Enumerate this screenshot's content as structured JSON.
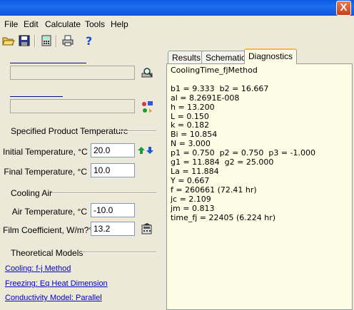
{
  "window": {
    "close_label": "X"
  },
  "menu": [
    "File",
    "Edit",
    "Calculate",
    "Tools",
    "Help"
  ],
  "toolbar_icons": [
    "open-folder-icon",
    "save-icon",
    "calculator-icon",
    "print-icon",
    "help-icon"
  ],
  "tabs": [
    {
      "label": "Results",
      "active": false
    },
    {
      "label": "Schematic",
      "active": false
    },
    {
      "label": "Diagnostics",
      "active": true
    }
  ],
  "product_temp": {
    "heading": "Specified Product Temperature",
    "initial_label": "Initial Temperature, °C",
    "initial_value": "20.0",
    "final_label": "Final Temperature, °C",
    "final_value": "10.0"
  },
  "cooling_air": {
    "heading": "Cooling Air",
    "air_label": "Air Temperature, °C",
    "air_value": "-10.0",
    "film_label": "Film Coefficient, W/m?°C",
    "film_value": "13.2"
  },
  "models": {
    "heading": "Theoretical Models",
    "cooling": "Cooling:  f-j Method",
    "freezing": "Freezing:  Eq Heat Dimension",
    "conductivity": "Conductivity Model:  Parallel"
  },
  "diagnostics": {
    "lines": [
      "CoolingTime_fjMethod",
      "",
      "b1 = 9.333  b2 = 16.667",
      "al = 8.2691E-008",
      "h = 13.200",
      "L = 0.150",
      "k = 0.182",
      "Bi = 10.854",
      "N = 3.000",
      "p1 = 0.750  p2 = 0.750  p3 = -1.000",
      "g1 = 11.884  g2 = 25.000",
      "La = 11.884",
      "Y = 0.667",
      "f = 260661 (72.41 hr)",
      "jc = 2.109",
      "jm = 0.813",
      "time_fj = 22405 (6.224 hr)"
    ]
  }
}
